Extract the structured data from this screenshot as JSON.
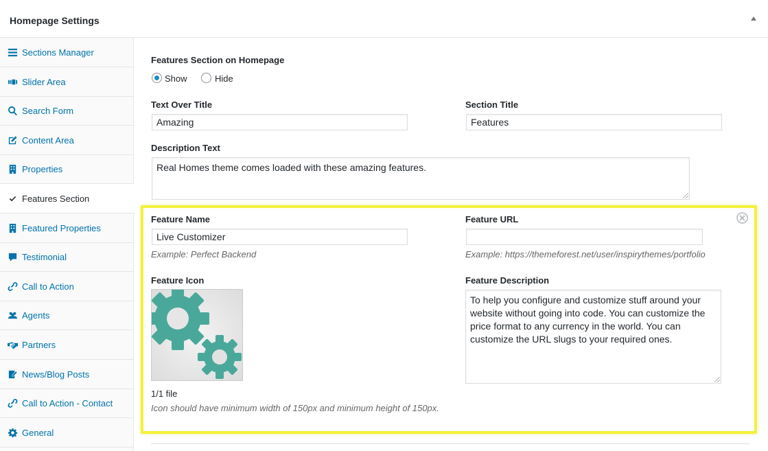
{
  "panel": {
    "title": "Homepage Settings"
  },
  "sidebar": {
    "items": [
      {
        "label": "Sections Manager",
        "icon": "menu-icon"
      },
      {
        "label": "Slider Area",
        "icon": "slides-icon"
      },
      {
        "label": "Search Form",
        "icon": "search-icon"
      },
      {
        "label": "Content Area",
        "icon": "edit-icon"
      },
      {
        "label": "Properties",
        "icon": "building-icon"
      },
      {
        "label": "Features Section",
        "icon": "check-icon",
        "active": true
      },
      {
        "label": "Featured Properties",
        "icon": "building-icon"
      },
      {
        "label": "Testimonial",
        "icon": "speech-bubble-icon"
      },
      {
        "label": "Call to Action",
        "icon": "link-icon"
      },
      {
        "label": "Agents",
        "icon": "users-icon"
      },
      {
        "label": "Partners",
        "icon": "handshake-icon"
      },
      {
        "label": "News/Blog Posts",
        "icon": "post-icon"
      },
      {
        "label": "Call to Action - Contact",
        "icon": "link-icon"
      },
      {
        "label": "General",
        "icon": "gear-icon"
      }
    ]
  },
  "features": {
    "section_label": "Features Section on Homepage",
    "show_label": "Show",
    "hide_label": "Hide",
    "selected": "Show",
    "text_over_title_label": "Text Over Title",
    "text_over_title_value": "Amazing",
    "section_title_label": "Section Title",
    "section_title_value": "Features",
    "description_label": "Description Text",
    "description_value": "Real Homes theme comes loaded with these amazing features."
  },
  "feature_item": {
    "name_label": "Feature Name",
    "name_value": "Live Customizer",
    "name_hint": "Example: Perfect Backend",
    "url_label": "Feature URL",
    "url_value": "",
    "url_hint": "Example: https://themeforest.net/user/inspirythemes/portfolio",
    "icon_label": "Feature Icon",
    "icon_image": "gears-icon",
    "file_count": "1/1 file",
    "icon_hint": "Icon should have minimum width of 150px and minimum height of 150px.",
    "description_label": "Feature Description",
    "description_value": "To help you configure and customize stuff around your website without going into code. You can customize the price format to any currency in the world. You can customize the URL slugs to your required ones."
  },
  "colors": {
    "link": "#0073aa",
    "highlight": "#f2f23a",
    "gear": "#4aa89b"
  }
}
